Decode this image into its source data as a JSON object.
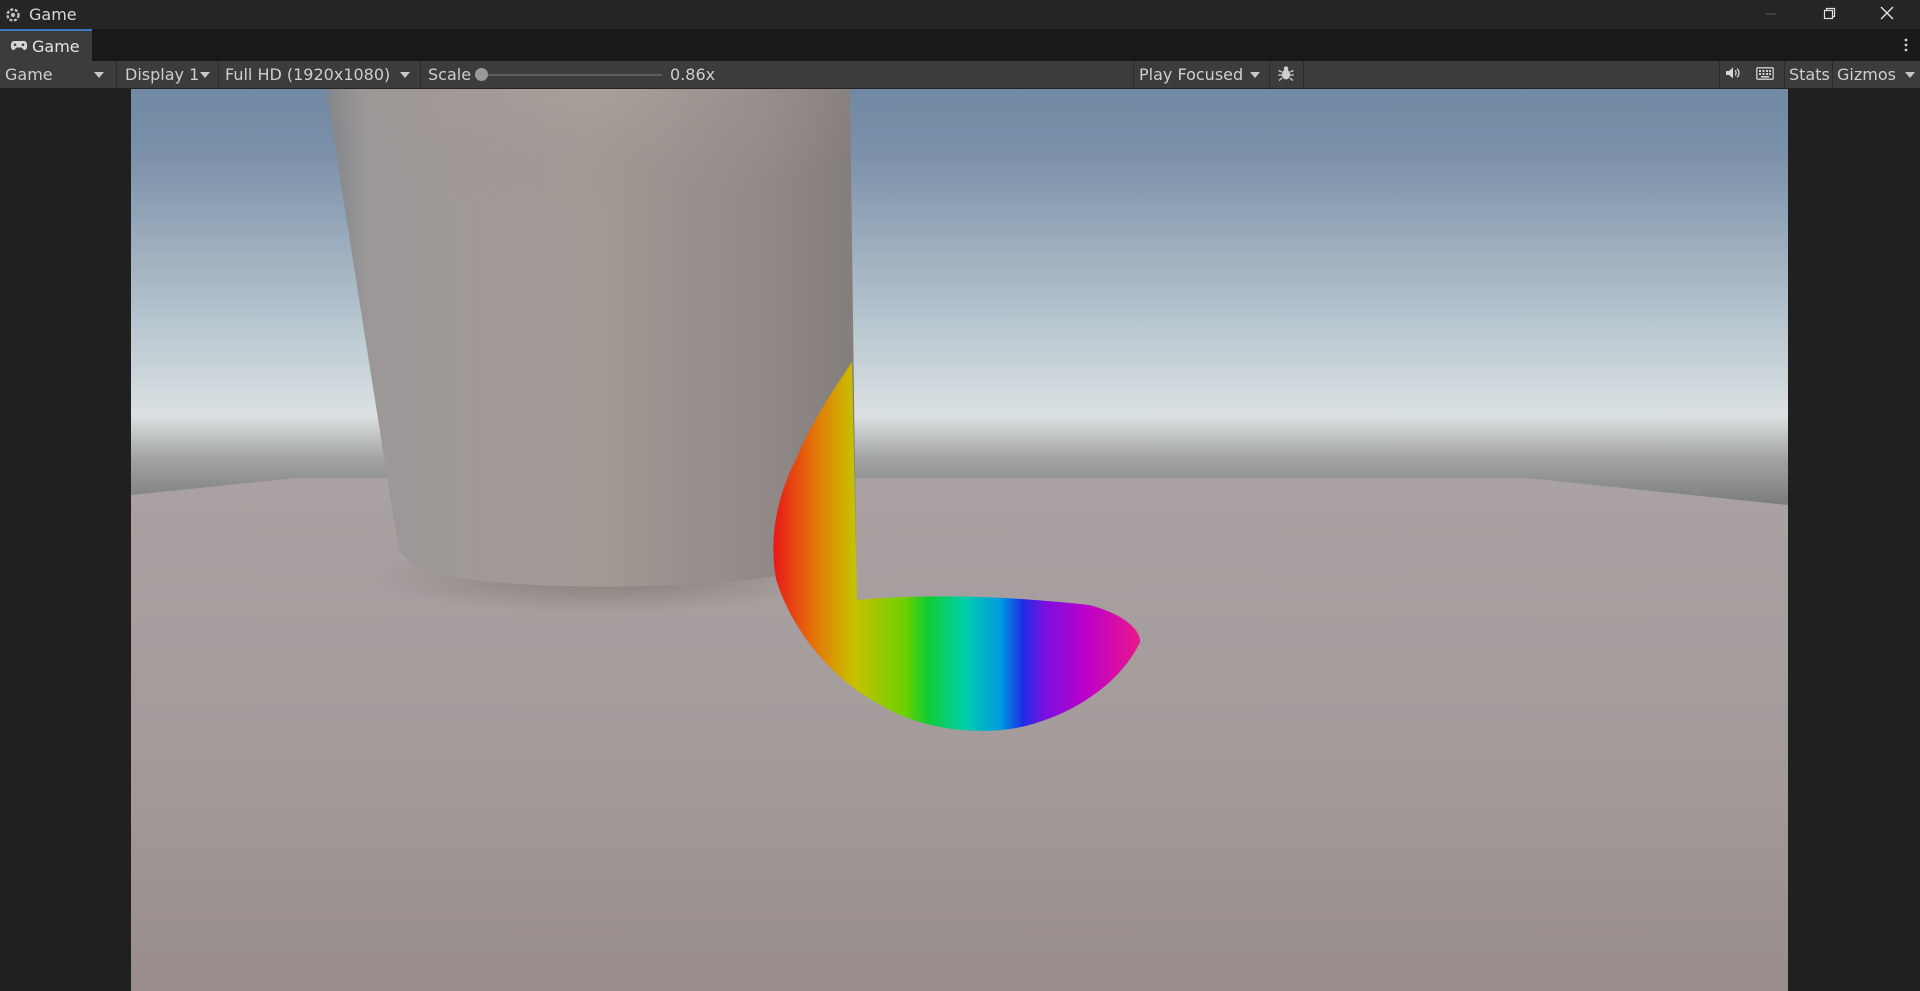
{
  "window": {
    "title": "Game",
    "icon": "unity-cog-icon",
    "controls": [
      "minimize-icon",
      "restore-icon",
      "close-icon"
    ]
  },
  "tab": {
    "label": "Game",
    "icon": "gamepad-icon",
    "menu_icon": "kebab-menu-icon"
  },
  "toolbar": {
    "view_mode": "Game",
    "display": "Display 1",
    "resolution": "Full HD (1920x1080)",
    "scale_label": "Scale",
    "scale_value": "0.86x",
    "scale_fraction": 0.0,
    "play_mode": "Play Focused",
    "bug_icon": "bug-icon",
    "audio_icon": "speaker-icon",
    "keyboard_icon": "keyboard-icon",
    "stats_label": "Stats",
    "gizmos_label": "Gizmos"
  },
  "scene": {
    "sky_top": "#7a91aa",
    "sky_horizon": "#d8dfe2",
    "ground": "#a59b9b",
    "pillar": "#9a918e",
    "object": "rainbow-hue-disc"
  }
}
